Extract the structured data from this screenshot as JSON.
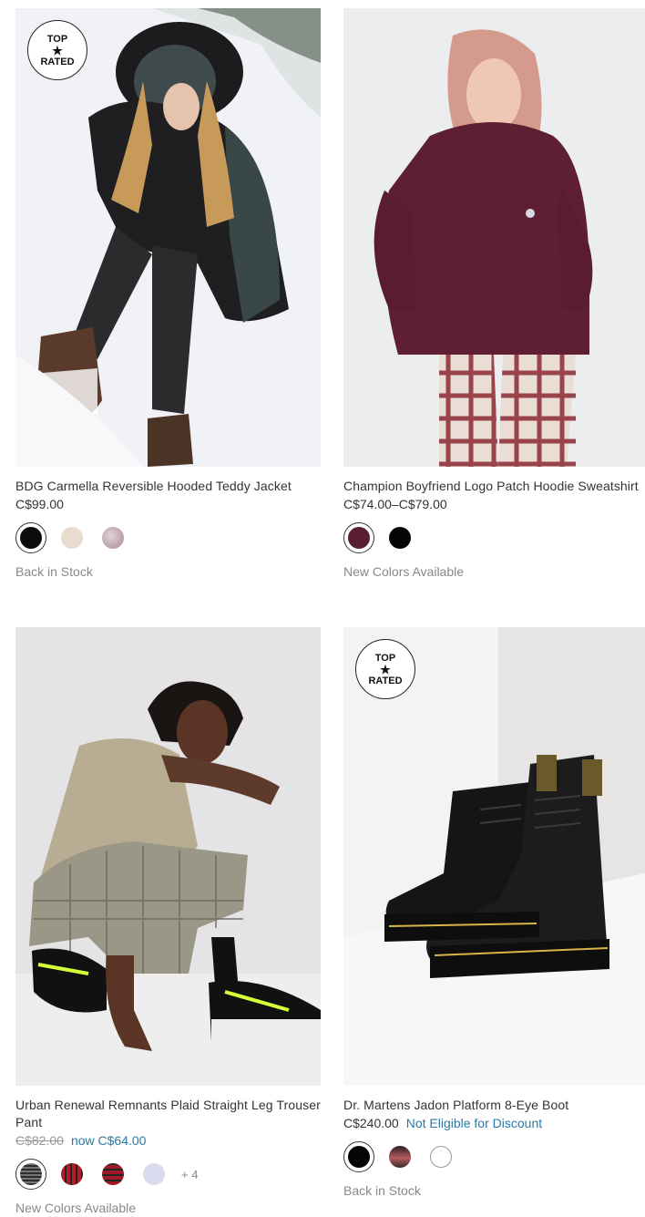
{
  "badge": {
    "top": "TOP",
    "star": "★",
    "rated": "RATED"
  },
  "products": [
    {
      "title": "BDG Carmella Reversible Hooded Teddy Jacket",
      "price": "C$99.00",
      "swatches": [
        "#0b0b0b",
        "#e8dccf",
        "#c9b1bb"
      ],
      "status": "Back in Stock",
      "top_rated": true
    },
    {
      "title": "Champion Boyfriend Logo Patch Hoodie Sweatshirt",
      "price": "C$74.00–C$79.00",
      "swatches": [
        "#5a1e31",
        "#050505"
      ],
      "status": "New Colors Available",
      "top_rated": false
    },
    {
      "title": "Urban Renewal Remnants Plaid Straight Leg Trouser Pant",
      "old_price": "C$82.00",
      "sale_price": "now C$64.00",
      "swatches": [
        "#8a8a8a",
        "#b11a26",
        "#a3172a",
        "#d9dbee"
      ],
      "more": "+ 4",
      "status": "New Colors Available",
      "top_rated": false
    },
    {
      "title": "Dr. Martens Jadon Platform 8-Eye Boot",
      "price": "C$240.00",
      "discount_note": "Not Eligible for Discount",
      "swatches": [
        "#050505",
        "#7a4a4f",
        "#ffffff"
      ],
      "status": "Back in Stock",
      "top_rated": true
    }
  ]
}
